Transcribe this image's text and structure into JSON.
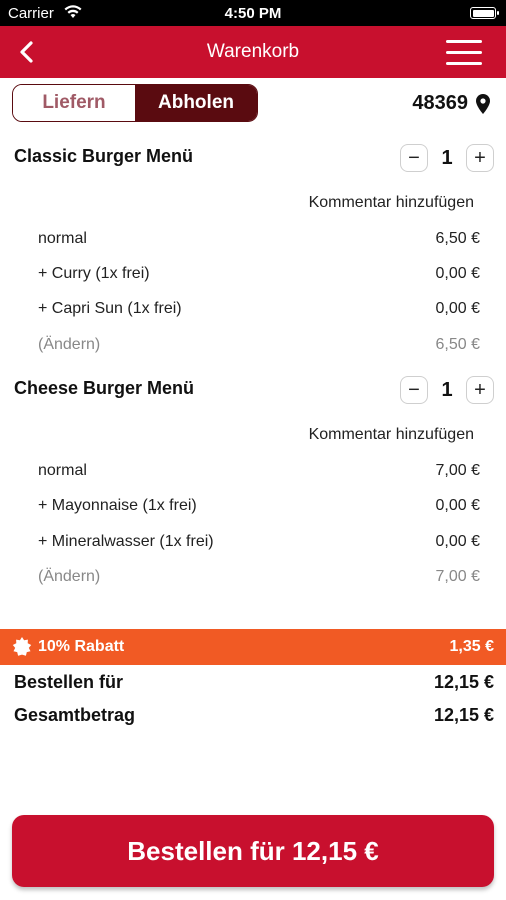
{
  "status": {
    "carrier": "Carrier",
    "time": "4:50 PM"
  },
  "nav": {
    "title": "Warenkorb"
  },
  "mode": {
    "deliver": "Liefern",
    "pickup": "Abholen",
    "active": "pickup"
  },
  "location": {
    "zip": "48369"
  },
  "items": [
    {
      "name": "Classic Burger Menü",
      "qty": "1",
      "comment_label": "Kommentar hinzufügen",
      "lines": [
        {
          "label": "normal",
          "price": "6,50 €"
        },
        {
          "label": "+ Curry (1x frei)",
          "price": "0,00 €"
        },
        {
          "label": "+ Capri Sun (1x frei)",
          "price": "0,00 €"
        },
        {
          "label": "(Ändern)",
          "price": "6,50 €"
        }
      ]
    },
    {
      "name": "Cheese Burger Menü",
      "qty": "1",
      "comment_label": "Kommentar hinzufügen",
      "lines": [
        {
          "label": "normal",
          "price": "7,00 €"
        },
        {
          "label": "+ Mayonnaise (1x frei)",
          "price": "0,00 €"
        },
        {
          "label": "+ Mineralwasser (1x frei)",
          "price": "0,00 €"
        },
        {
          "label": "(Ändern)",
          "price": "7,00 €"
        }
      ]
    }
  ],
  "discount": {
    "label": "10% Rabatt",
    "amount": "1,35 €"
  },
  "summary": {
    "order_for_label": "Bestellen für",
    "order_for_value": "12,15 €",
    "total_label": "Gesamtbetrag",
    "total_value": "12,15 €"
  },
  "cta": {
    "label": "Bestellen für 12,15 €"
  },
  "colors": {
    "brand": "#c8102e",
    "dark": "#5a0b10",
    "discount": "#f15a24"
  }
}
